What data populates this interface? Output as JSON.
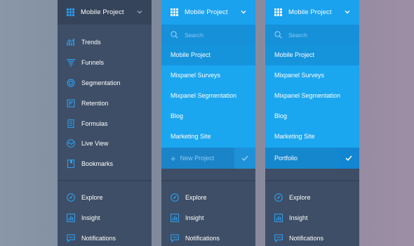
{
  "project_title": "Mobile Project",
  "panel1": {
    "nav": [
      {
        "label": "Trends",
        "icon": "trends-icon"
      },
      {
        "label": "Funnels",
        "icon": "funnels-icon"
      },
      {
        "label": "Segmentation",
        "icon": "segmentation-icon"
      },
      {
        "label": "Retention",
        "icon": "retention-icon"
      },
      {
        "label": "Formulas",
        "icon": "formulas-icon"
      },
      {
        "label": "Live View",
        "icon": "live-view-icon"
      },
      {
        "label": "Bookmarks",
        "icon": "bookmarks-icon"
      }
    ]
  },
  "dropdown": {
    "search_placeholder": "Search",
    "projects": [
      "Mobile Project",
      "Mixpanel Surveys",
      "Mixpanel Segmentation",
      "Blog",
      "Marketing Site"
    ],
    "new_project": "New Project",
    "portfolio": "Portfolio"
  },
  "bottom_nav": [
    {
      "label": "Explore",
      "icon": "compass-icon"
    },
    {
      "label": "Insight",
      "icon": "insight-icon"
    },
    {
      "label": "Notifications",
      "icon": "chat-icon"
    }
  ],
  "colors": {
    "accent": "#1aa2ef",
    "panel": "#3e4e66",
    "icon_blue": "#2e9ef0"
  }
}
